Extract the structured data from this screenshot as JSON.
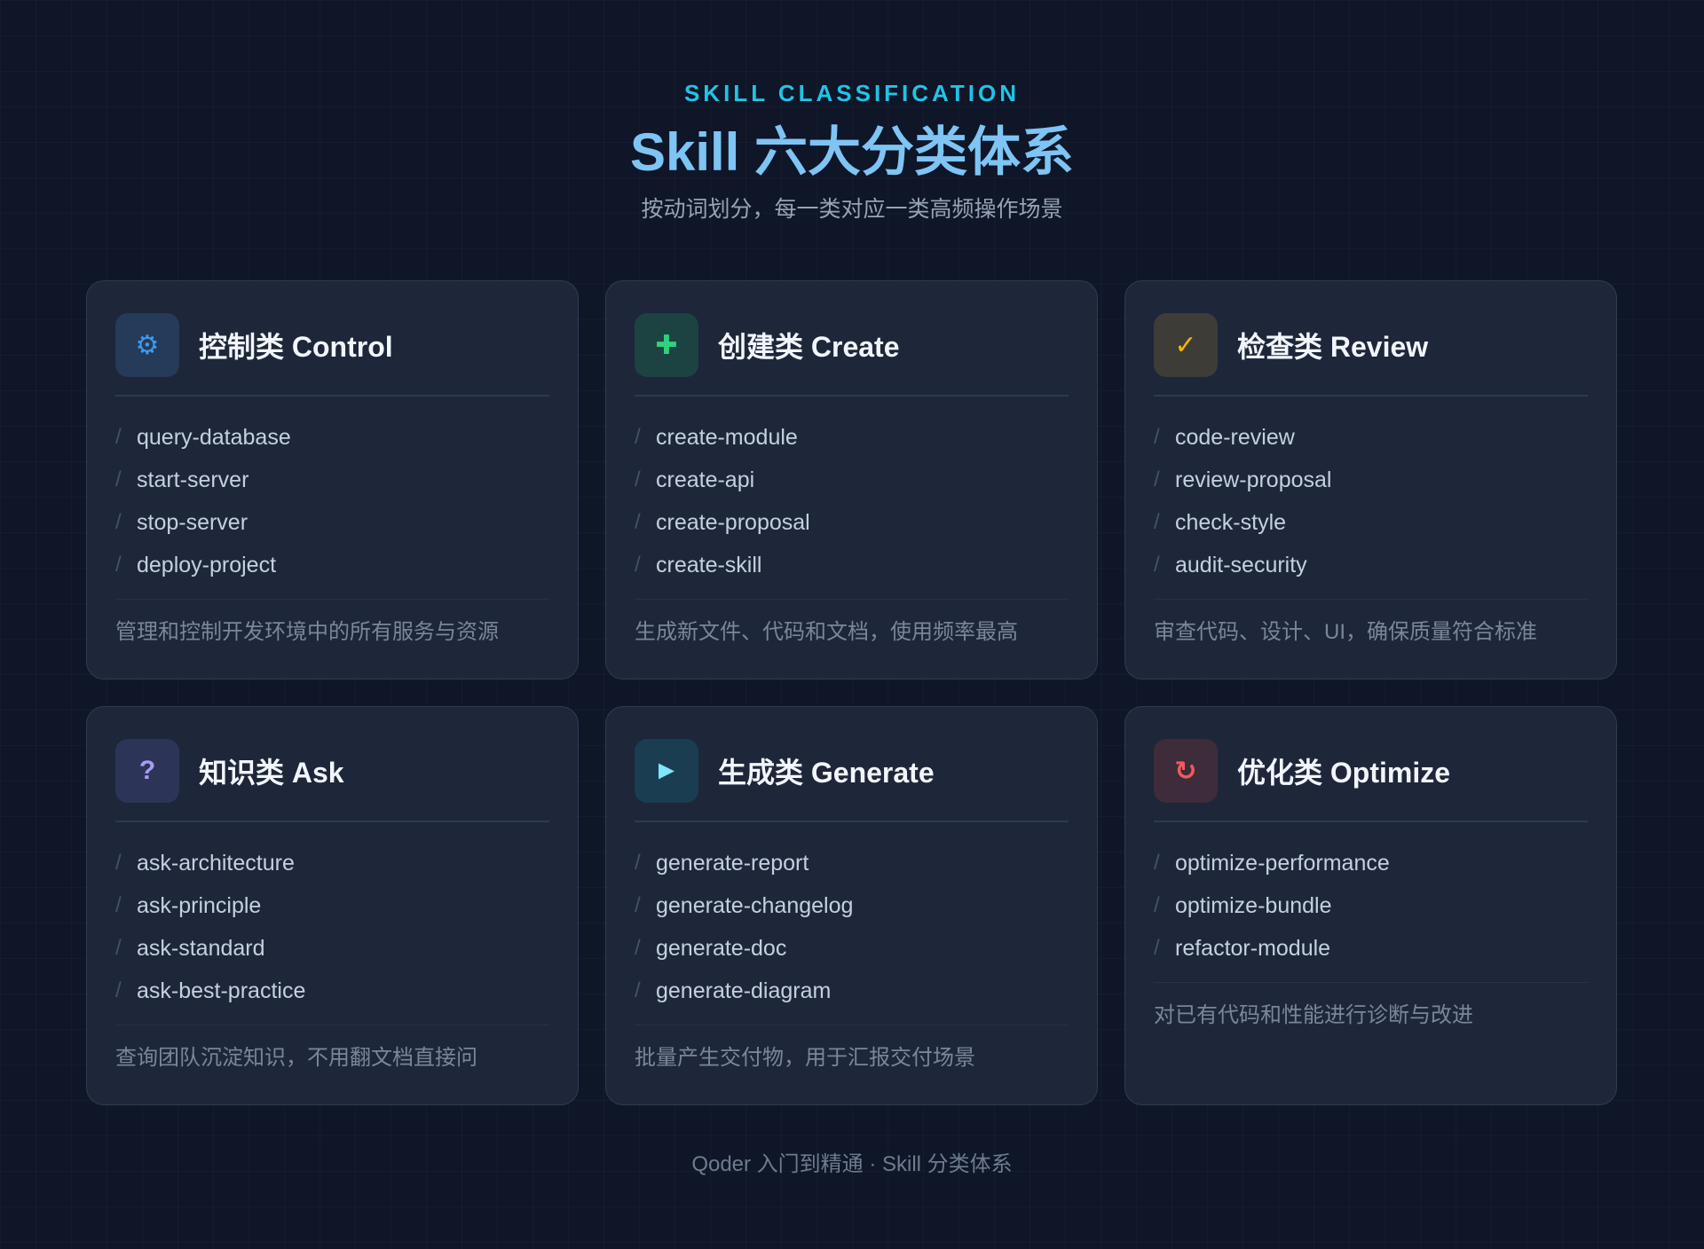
{
  "header": {
    "eyebrow": "SKILL CLASSIFICATION",
    "title": "Skill 六大分类体系",
    "subtitle": "按动词划分，每一类对应一类高频操作场景"
  },
  "cards": [
    {
      "title": "控制类 Control",
      "icon": "⚙",
      "icon_name": "gear-icon",
      "icon_color": "#3b9bf0",
      "icon_bg": "#263a5a",
      "skills": [
        "query-database",
        "start-server",
        "stop-server",
        "deploy-project"
      ],
      "description": "管理和控制开发环境中的所有服务与资源"
    },
    {
      "title": "创建类 Create",
      "icon": "✚",
      "icon_name": "plus-icon",
      "icon_color": "#30d07f",
      "icon_bg": "#1d4242",
      "skills": [
        "create-module",
        "create-api",
        "create-proposal",
        "create-skill"
      ],
      "description": "生成新文件、代码和文档，使用频率最高"
    },
    {
      "title": "检查类 Review",
      "icon": "✓",
      "icon_name": "check-icon",
      "icon_color": "#f6b40c",
      "icon_bg": "#3d3c37",
      "skills": [
        "code-review",
        "review-proposal",
        "check-style",
        "audit-security"
      ],
      "description": "审查代码、设计、UI，确保质量符合标准"
    },
    {
      "title": "知识类 Ask",
      "icon": "?",
      "icon_name": "question-icon",
      "icon_color": "#a99cf5",
      "icon_bg": "#2c3458",
      "skills": [
        "ask-architecture",
        "ask-principle",
        "ask-standard",
        "ask-best-practice"
      ],
      "description": "查询团队沉淀知识，不用翻文档直接问"
    },
    {
      "title": "生成类 Generate",
      "icon": "►",
      "icon_name": "play-icon",
      "icon_color": "#7fe6fb",
      "icon_bg": "#1b3d52",
      "skills": [
        "generate-report",
        "generate-changelog",
        "generate-doc",
        "generate-diagram"
      ],
      "description": "批量产生交付物，用于汇报交付场景"
    },
    {
      "title": "优化类 Optimize",
      "icon": "↻",
      "icon_name": "refresh-icon",
      "icon_color": "#f25a5a",
      "icon_bg": "#3e2c3a",
      "skills": [
        "optimize-performance",
        "optimize-bundle",
        "refactor-module"
      ],
      "description": "对已有代码和性能进行诊断与改进"
    }
  ],
  "footer": {
    "text": "Qoder 入门到精通 · Skill 分类体系"
  }
}
